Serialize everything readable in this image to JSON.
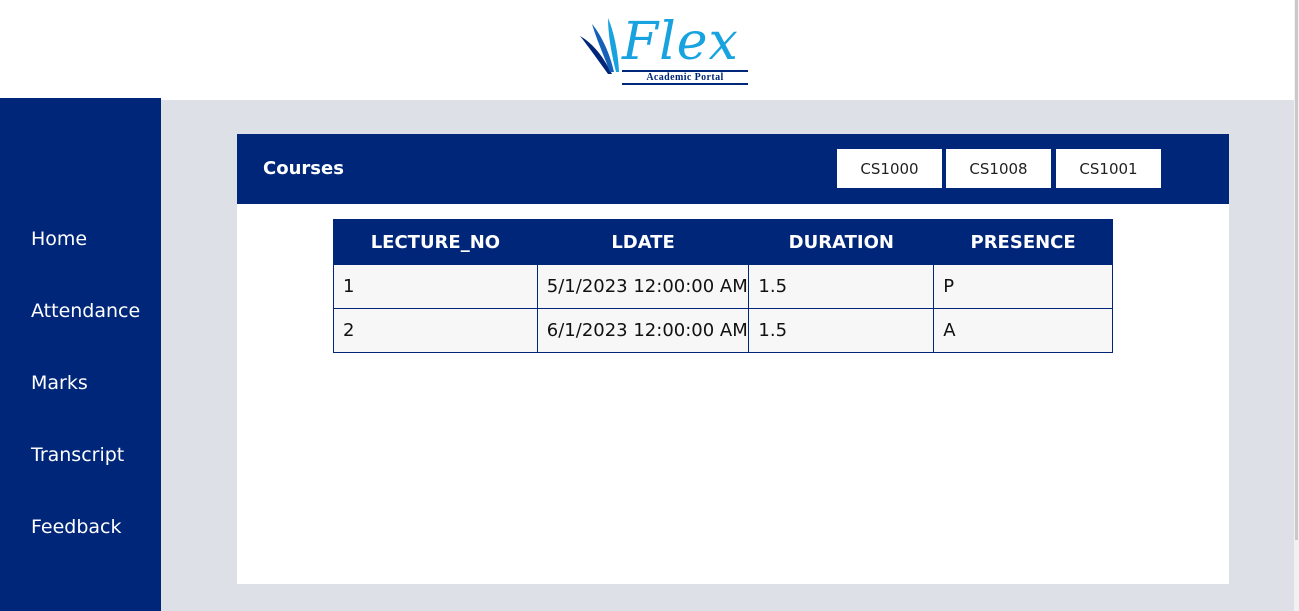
{
  "brand": {
    "title": "Flex",
    "subtitle": "Academic Portal"
  },
  "sidebar": {
    "items": [
      {
        "label": "Home"
      },
      {
        "label": "Attendance"
      },
      {
        "label": "Marks"
      },
      {
        "label": "Transcript"
      },
      {
        "label": "Feedback"
      }
    ]
  },
  "courses": {
    "title": "Courses",
    "buttons": [
      "CS1000",
      "CS1008",
      "CS1001"
    ]
  },
  "attendance_table": {
    "headers": [
      "LECTURE_NO",
      "LDATE",
      "DURATION",
      "PRESENCE"
    ],
    "rows": [
      [
        "1",
        "5/1/2023 12:00:00 AM",
        "1.5",
        "P"
      ],
      [
        "2",
        "6/1/2023 12:00:00 AM",
        "1.5",
        "A"
      ]
    ]
  },
  "colors": {
    "primary": "#00267a",
    "accent": "#17a2e0",
    "background": "#dde0e7"
  }
}
